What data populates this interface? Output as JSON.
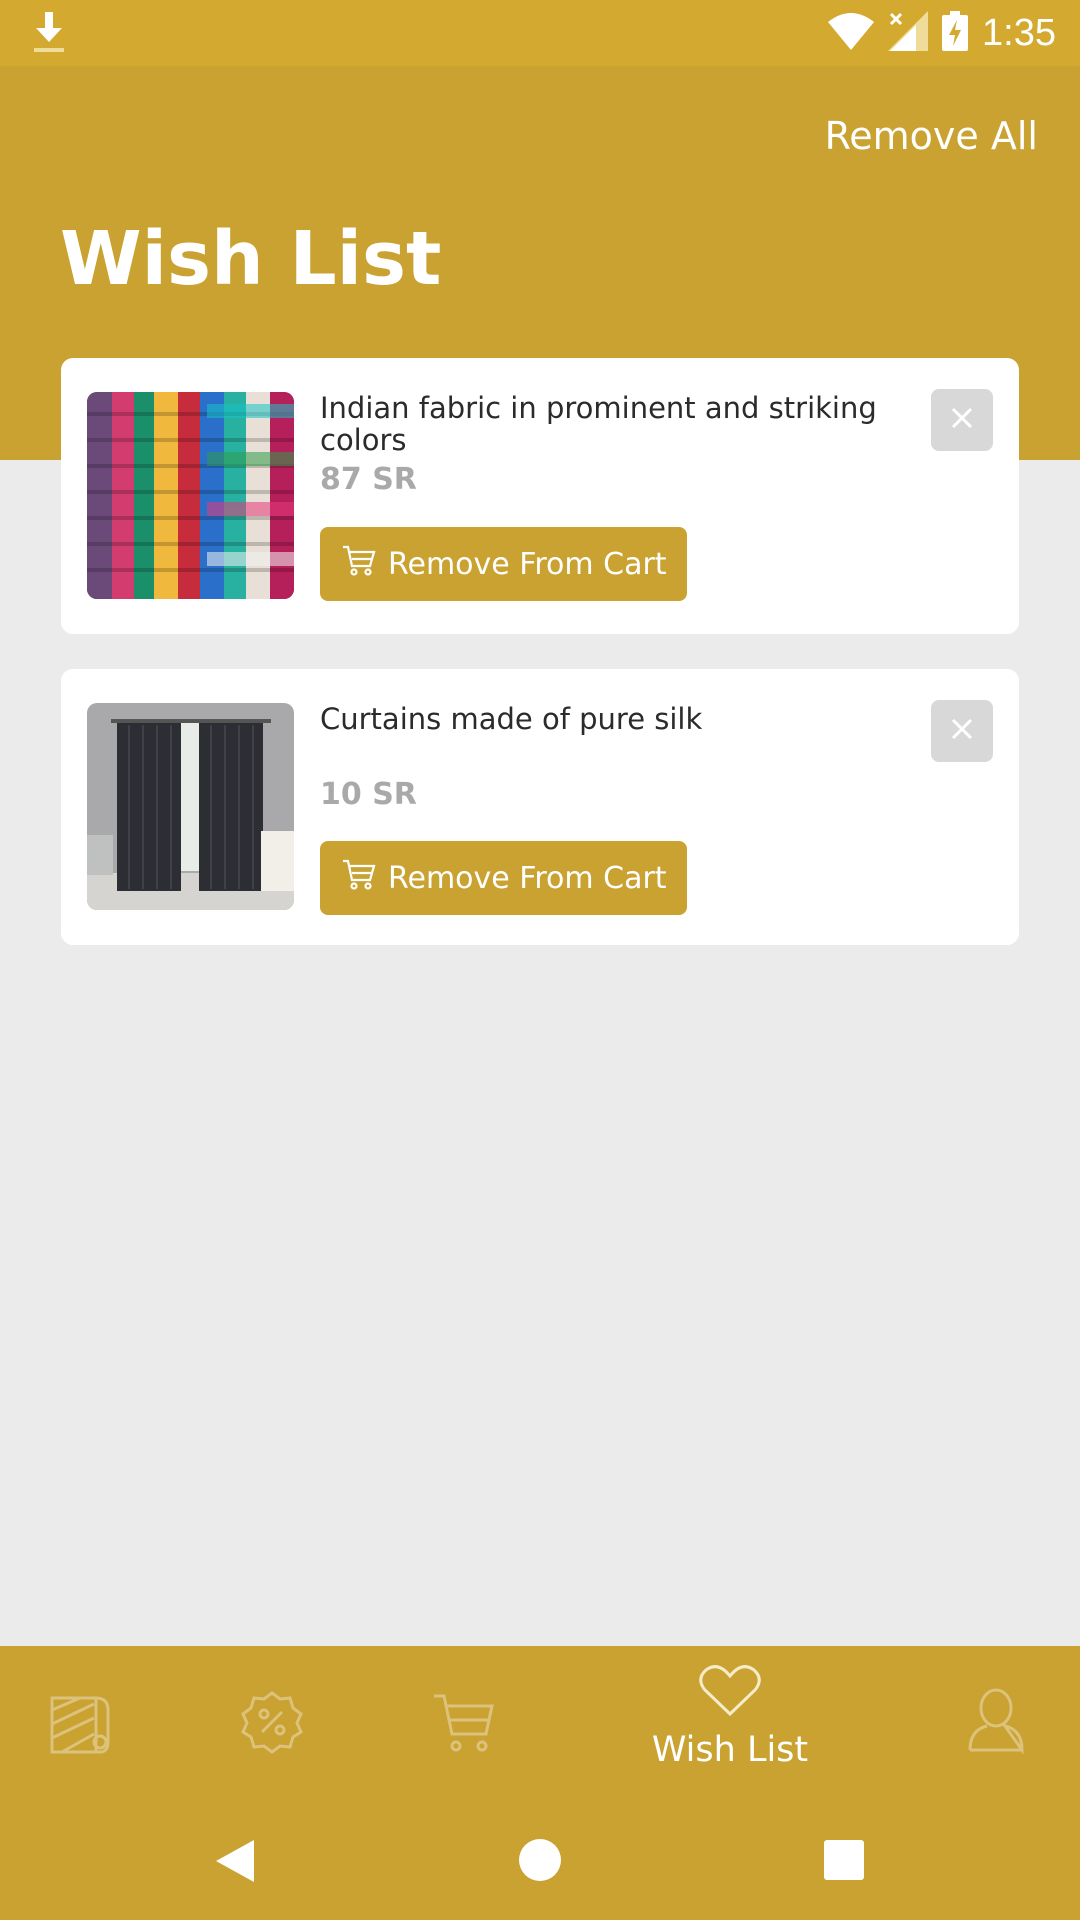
{
  "status_bar": {
    "time": "1:35",
    "icons": [
      "download-icon",
      "wifi-icon",
      "signal-icon",
      "battery-charging-icon"
    ]
  },
  "header": {
    "remove_all_label": "Remove All",
    "title": "Wish List"
  },
  "items": [
    {
      "name": "Indian fabric in prominent and striking colors",
      "price": "87 SR",
      "button_label": "Remove From Cart",
      "image": "colorful-fabric-rolls"
    },
    {
      "name": "Curtains made of pure silk",
      "price": "10 SR",
      "button_label": "Remove From Cart",
      "image": "dark-curtains-room"
    }
  ],
  "bottom_nav": {
    "items": [
      {
        "icon": "fabric-roll-icon",
        "label": ""
      },
      {
        "icon": "discount-badge-icon",
        "label": ""
      },
      {
        "icon": "cart-icon",
        "label": ""
      },
      {
        "icon": "heart-icon",
        "label": "Wish List",
        "active": true
      },
      {
        "icon": "user-profile-icon",
        "label": ""
      }
    ]
  },
  "system_nav": [
    "back-icon",
    "home-icon",
    "recents-icon"
  ],
  "colors": {
    "primary": "#c9a232",
    "status_bar": "#d3a930",
    "background": "#ebebeb",
    "card": "#ffffff",
    "price_text": "#a9a9a9",
    "close_button_bg": "#d8d8d8"
  }
}
